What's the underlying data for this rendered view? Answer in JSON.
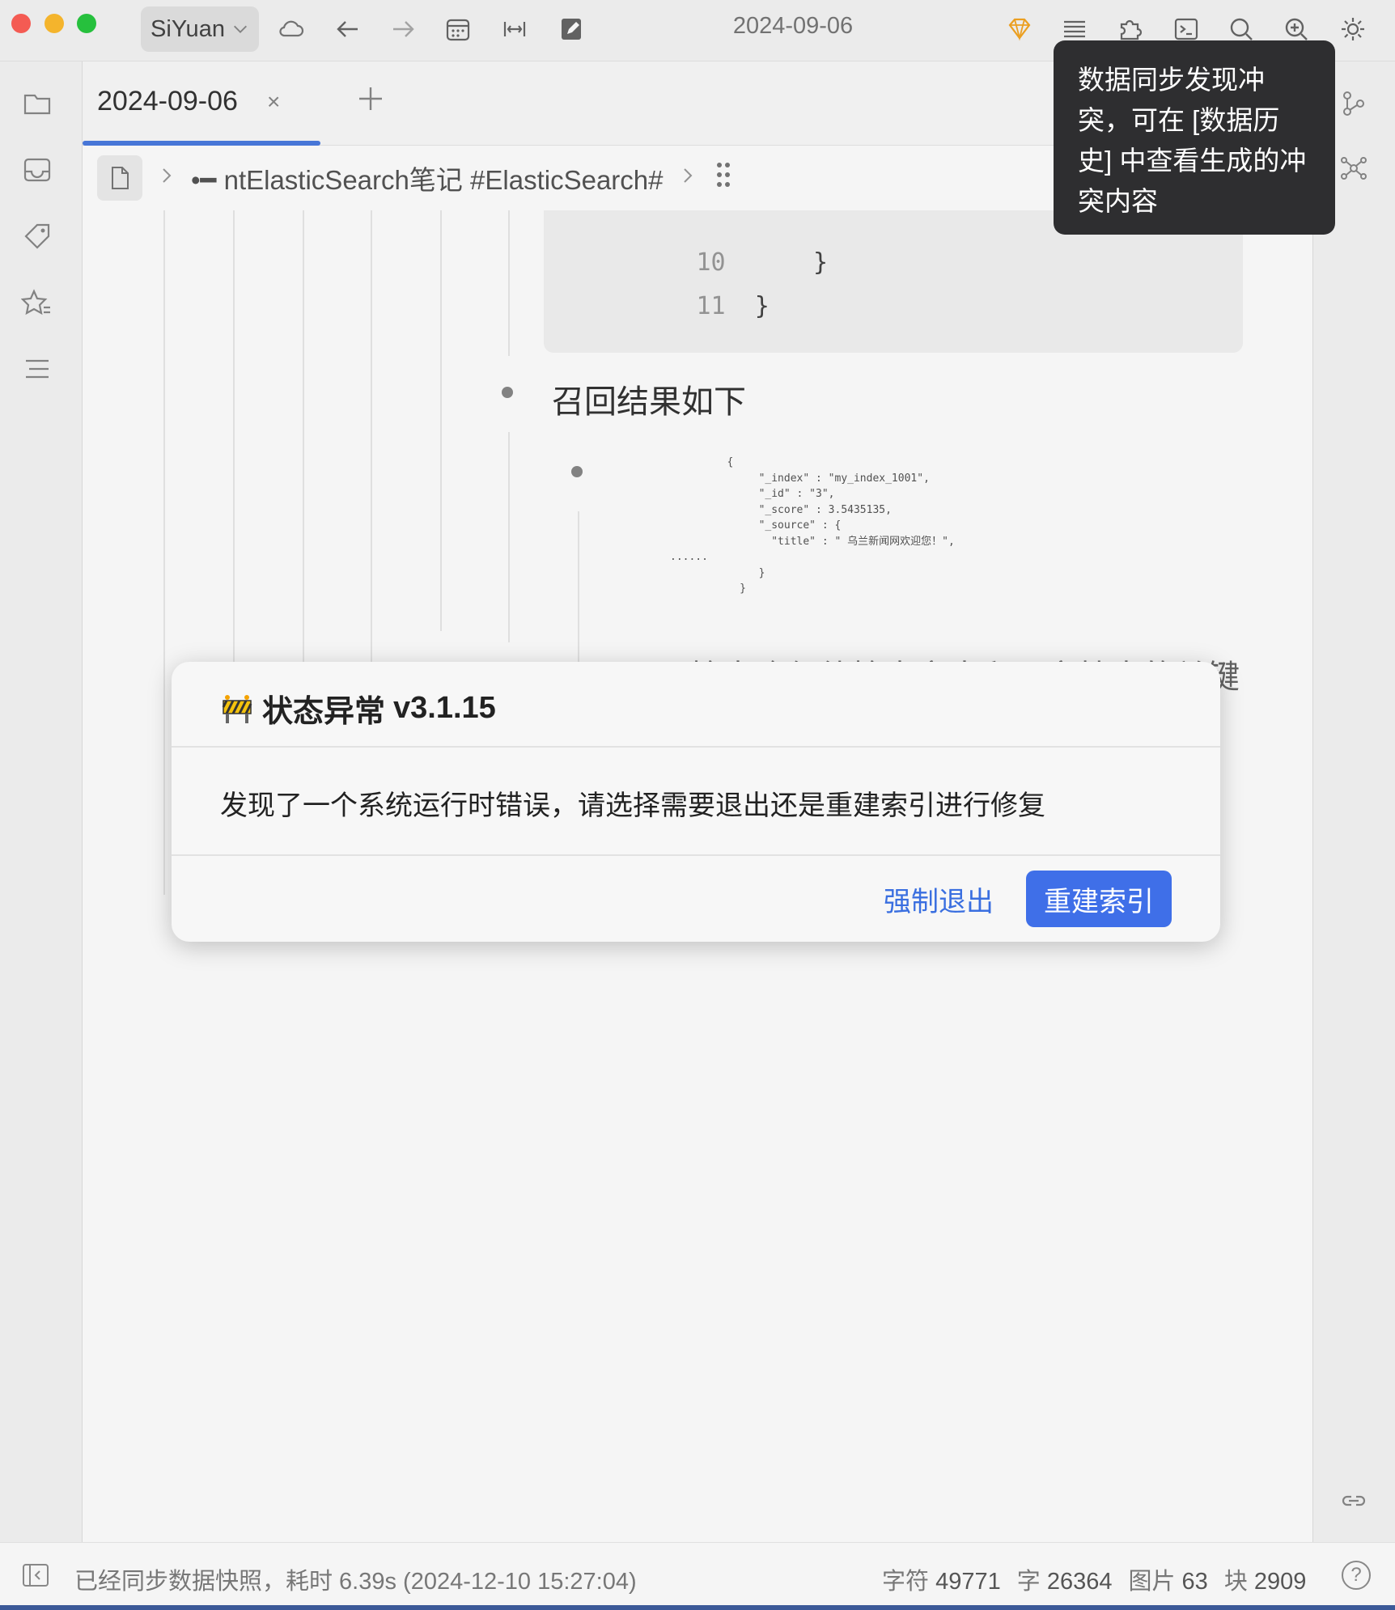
{
  "titlebar": {
    "workspace": "SiYuan",
    "title": "2024-09-06",
    "icons": [
      "cloud-sync-icon",
      "back-icon",
      "forward-icon",
      "calendar-icon",
      "fit-width-icon",
      "edit-icon",
      "vip-icon",
      "outline-icon",
      "plugin-icon",
      "terminal-icon",
      "search-icon",
      "zoom-icon",
      "theme-icon"
    ]
  },
  "leftdock": {
    "icons": [
      "file-tree-icon",
      "inbox-icon",
      "tag-icon",
      "bookmark-star-icon",
      "outline-list-icon"
    ]
  },
  "tab": {
    "label": "2024-09-06",
    "close": "×"
  },
  "breadcrumb": {
    "path": "•━ ntElasticSearch笔记 #ElasticSearch#"
  },
  "content": {
    "code_lines": [
      {
        "num": "10",
        "text": "      }"
      },
      {
        "num": "11",
        "text": "  }"
      }
    ],
    "recall_heading": "召回结果如下",
    "json_snippet": "         {\n              \"_index\" : \"my_index_1001\",\n              \"_id\" : \"3\",\n              \"_score\" : 3.5435135,\n              \"_source\" : {\n                \"title\" : \" 乌兰新闻网欢迎您！\",\n......\n              }\n           }",
    "partial_line": "检索确保待检索文本和原文档中的关键"
  },
  "dialog": {
    "title": "状态异常",
    "version": "v3.1.15",
    "message": "发现了一个系统运行时错误，请选择需要退出还是重建索引进行修复",
    "cancel_label": "强制退出",
    "confirm_label": "重建索引"
  },
  "tooltip": {
    "text": "数据同步发现冲突，可在 [数据历史] 中查看生成的冲突内容"
  },
  "statusbar": {
    "message": "已经同步数据快照，耗时 6.39s (2024-12-10 15:27:04)",
    "chars_label": "字符",
    "chars_value": "49771",
    "words_label": "字",
    "words_value": "26364",
    "images_label": "图片",
    "images_value": "63",
    "blocks_label": "块",
    "blocks_value": "2909",
    "help": "?"
  },
  "colors": {
    "accent": "#3f6fe8",
    "tooltip_bg": "#2e2e30",
    "vip": "#f5a623"
  }
}
